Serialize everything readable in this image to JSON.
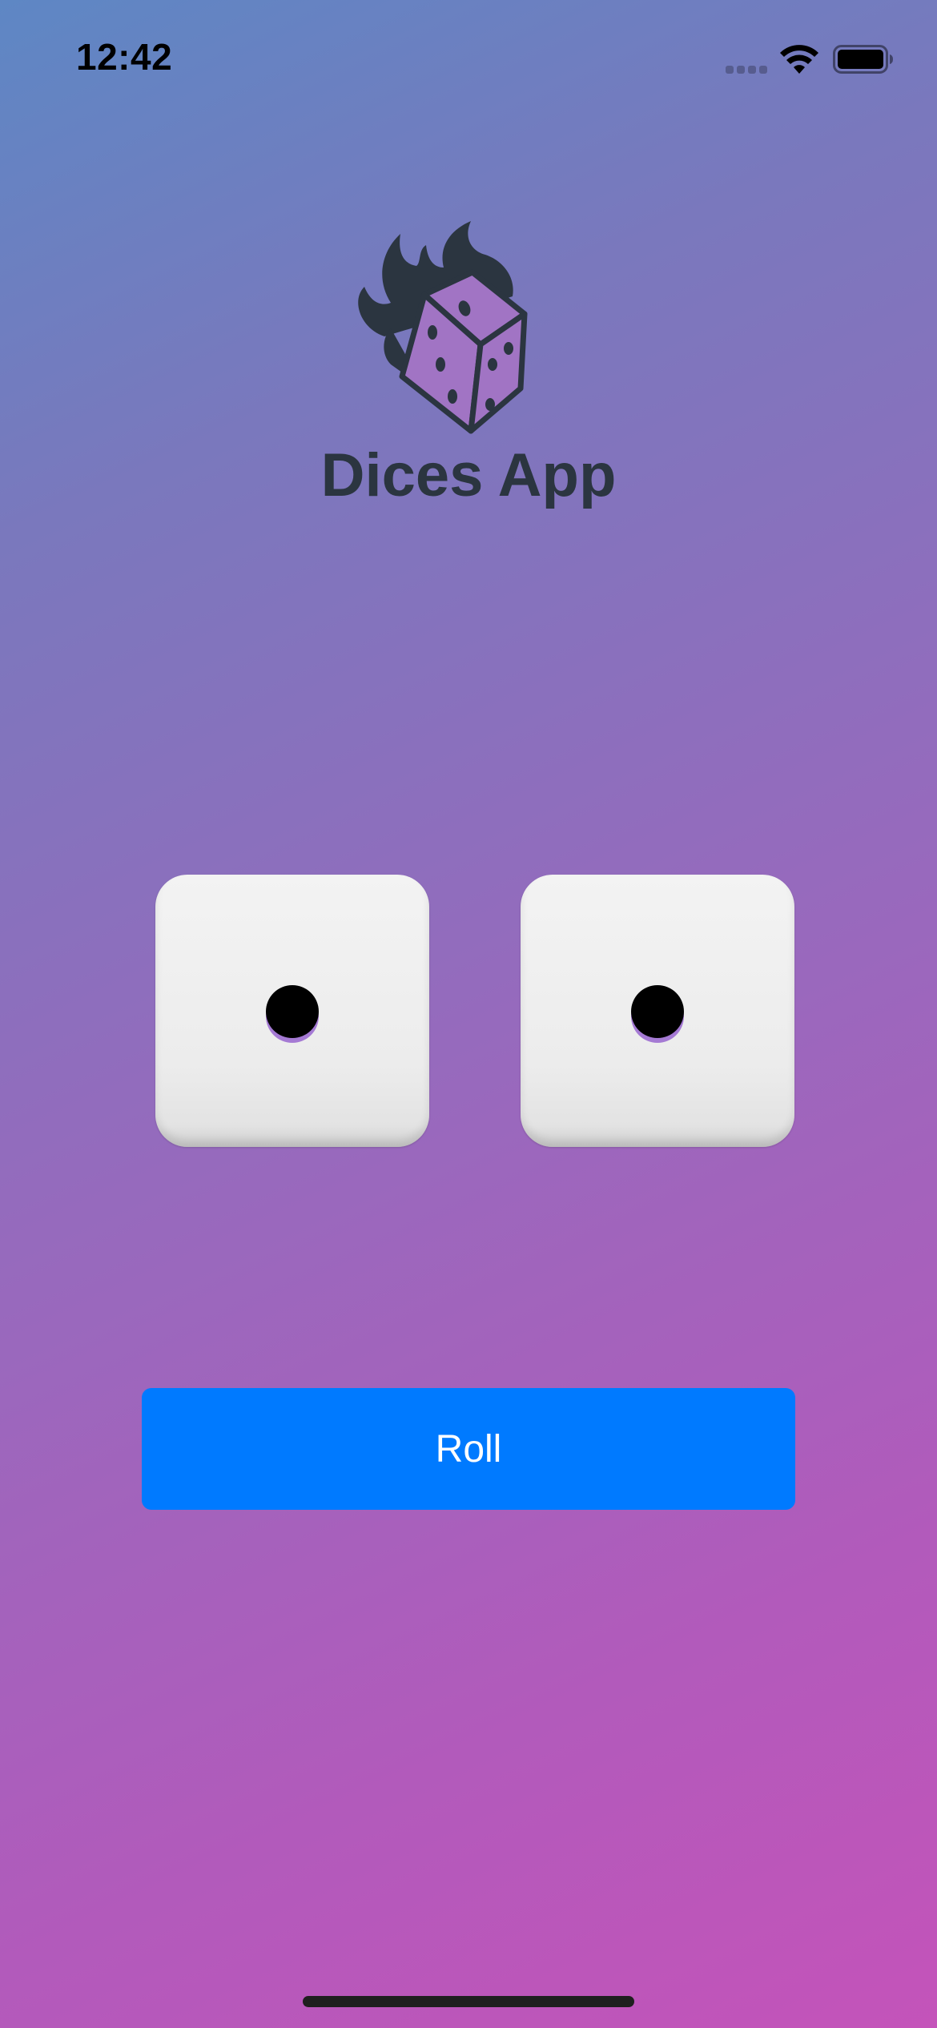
{
  "status_bar": {
    "time": "12:42",
    "icons": [
      "cellular-signal-icon",
      "wifi-icon",
      "battery-icon"
    ]
  },
  "header": {
    "logo_icon": "flaming-dice-logo-icon",
    "title": "Dices App"
  },
  "dice": [
    {
      "face_value": 1
    },
    {
      "face_value": 1
    }
  ],
  "roll_button": {
    "label": "Roll"
  },
  "colors": {
    "button_background": "#007aff",
    "button_text": "#ffffff",
    "title_text": "#2b3540",
    "gradient_start": "#5e87c4",
    "gradient_end": "#c453ba"
  }
}
